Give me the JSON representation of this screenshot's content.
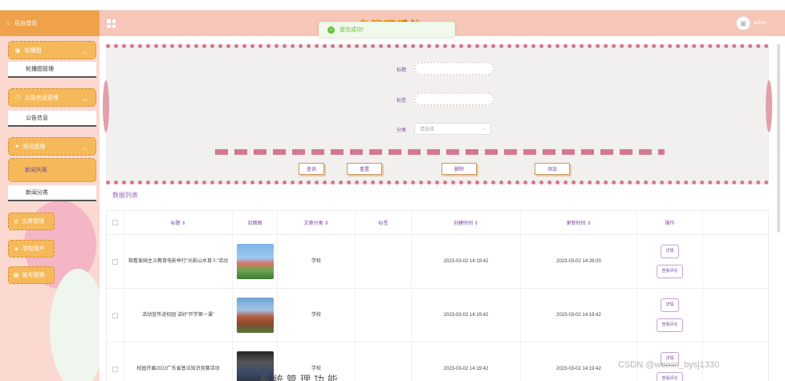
{
  "header": {
    "home_label": "后台首页",
    "title": "...务管理系统",
    "username": "admin"
  },
  "toast": {
    "text": "提交成功!"
  },
  "sidebar": {
    "menus": [
      {
        "label": "轮播图",
        "sub": "轮播图管理"
      },
      {
        "label": "公告信息管理",
        "sub": "公告信息"
      },
      {
        "label": "资讯管理",
        "sub": "新闻列表",
        "sub2": "新闻分类"
      }
    ],
    "side_items": [
      "文章管理",
      "学校用户",
      "账号管理"
    ]
  },
  "search": {
    "labels": [
      "标题",
      "标签",
      "分类"
    ],
    "select_placeholder": "请选择",
    "buttons": {
      "query": "查询",
      "reset": "重置",
      "delete": "删除",
      "add": "添加"
    }
  },
  "section_title": "数据列表",
  "table": {
    "headers": [
      "",
      "标题 ⇕",
      "封面图",
      "文章分类 ⇕",
      "标签",
      "创建时间 ⇕",
      "更新时间 ⇕",
      "操作"
    ],
    "rows": [
      {
        "title": "观看爱国主义教育电影举行“光影山水育人”活动",
        "category": "学校",
        "tag": "",
        "created": "2023-03-02 14:19:42",
        "updated": "2023-03-02 14:26:00",
        "ops": [
          "详情",
          "查看评论"
        ]
      },
      {
        "title": "活动宣传进校园 讲好“开学第一课”",
        "category": "学校",
        "tag": "",
        "created": "2023-03-02 14:19:42",
        "updated": "2023-03-02 14:19:42",
        "ops": [
          "详情",
          "查看评论"
        ]
      },
      {
        "title": "校园开展2022广东省普法知识竞赛活动",
        "category": "学校",
        "tag": "",
        "created": "2023-03-02 14:19:42",
        "updated": "2023-03-02 14:19:42",
        "ops": [
          "详情",
          "查看评论"
        ]
      }
    ]
  },
  "watermark": "CSDN @weixin_bysj1330",
  "bottom_text": "...系统管理功能..."
}
